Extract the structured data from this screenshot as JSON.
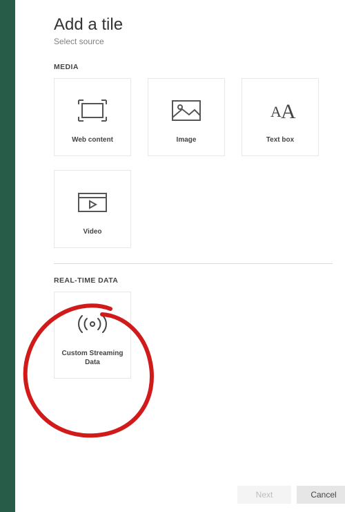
{
  "header": {
    "title": "Add a tile",
    "subtitle": "Select source"
  },
  "sections": {
    "media": {
      "heading": "MEDIA",
      "tiles": [
        {
          "label": "Web content"
        },
        {
          "label": "Image"
        },
        {
          "label": "Text box"
        },
        {
          "label": "Video"
        }
      ]
    },
    "realtime": {
      "heading": "REAL-TIME DATA",
      "tiles": [
        {
          "label": "Custom Streaming Data"
        }
      ]
    }
  },
  "footer": {
    "next": "Next",
    "cancel": "Cancel"
  }
}
